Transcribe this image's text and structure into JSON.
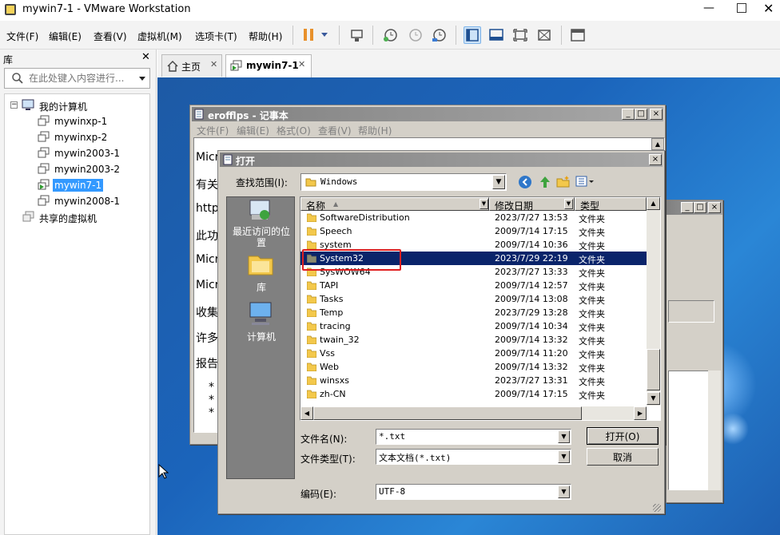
{
  "window": {
    "title": "mywin7-1 - VMware Workstation"
  },
  "menu": [
    "文件(F)",
    "编辑(E)",
    "查看(V)",
    "虚拟机(M)",
    "选项卡(T)",
    "帮助(H)"
  ],
  "library": {
    "title": "库",
    "search_placeholder": "在此处键入内容进行...",
    "root": "我的计算机",
    "vms": [
      "mywinxp-1",
      "mywinxp-2",
      "mywin2003-1",
      "mywin2003-2",
      "mywin7-1",
      "mywin2008-1"
    ],
    "selected": "mywin7-1",
    "shared": "共享的虚拟机"
  },
  "tabs": [
    {
      "label": "主页"
    },
    {
      "label": "mywin7-1"
    }
  ],
  "notepad": {
    "title": "erofflps - 记事本",
    "menu": [
      "文件(F)",
      "编辑(E)",
      "格式(O)",
      "查看(V)",
      "帮助(H)"
    ],
    "lines": [
      "Micr",
      "有关",
      "http",
      "此功",
      "Micr",
      "Micr",
      "收集",
      "许多",
      "报告",
      "*",
      "*",
      "*"
    ]
  },
  "open_dialog": {
    "title": "打开",
    "look_in_label": "查找范围(I):",
    "look_in_value": "Windows",
    "places": [
      "最近访问的位置",
      "库",
      "计算机"
    ],
    "columns": [
      "名称",
      "修改日期",
      "类型"
    ],
    "files": [
      {
        "name": "SoftwareDistribution",
        "date": "2023/7/27 13:53",
        "type": "文件夹"
      },
      {
        "name": "Speech",
        "date": "2009/7/14 17:15",
        "type": "文件夹"
      },
      {
        "name": "system",
        "date": "2009/7/14 10:36",
        "type": "文件夹"
      },
      {
        "name": "System32",
        "date": "2023/7/29 22:19",
        "type": "文件夹",
        "selected": true
      },
      {
        "name": "SysWOW64",
        "date": "2023/7/27 13:33",
        "type": "文件夹"
      },
      {
        "name": "TAPI",
        "date": "2009/7/14 12:57",
        "type": "文件夹"
      },
      {
        "name": "Tasks",
        "date": "2009/7/14 13:08",
        "type": "文件夹"
      },
      {
        "name": "Temp",
        "date": "2023/7/29 13:28",
        "type": "文件夹"
      },
      {
        "name": "tracing",
        "date": "2009/7/14 10:34",
        "type": "文件夹"
      },
      {
        "name": "twain_32",
        "date": "2009/7/14 13:32",
        "type": "文件夹"
      },
      {
        "name": "Vss",
        "date": "2009/7/14 11:20",
        "type": "文件夹"
      },
      {
        "name": "Web",
        "date": "2009/7/14 13:32",
        "type": "文件夹"
      },
      {
        "name": "winsxs",
        "date": "2023/7/27 13:31",
        "type": "文件夹"
      },
      {
        "name": "zh-CN",
        "date": "2009/7/14 17:15",
        "type": "文件夹"
      }
    ],
    "filename_label": "文件名(N):",
    "filename_value": "*.txt",
    "filetype_label": "文件类型(T):",
    "filetype_value": "文本文档(*.txt)",
    "encoding_label": "编码(E):",
    "encoding_value": "UTF-8",
    "open_button": "打开(O)",
    "cancel_button": "取消"
  },
  "colors": {
    "selection": "#0a246a",
    "highlight_box": "#e02020",
    "vm_selected": "#3399ff"
  }
}
